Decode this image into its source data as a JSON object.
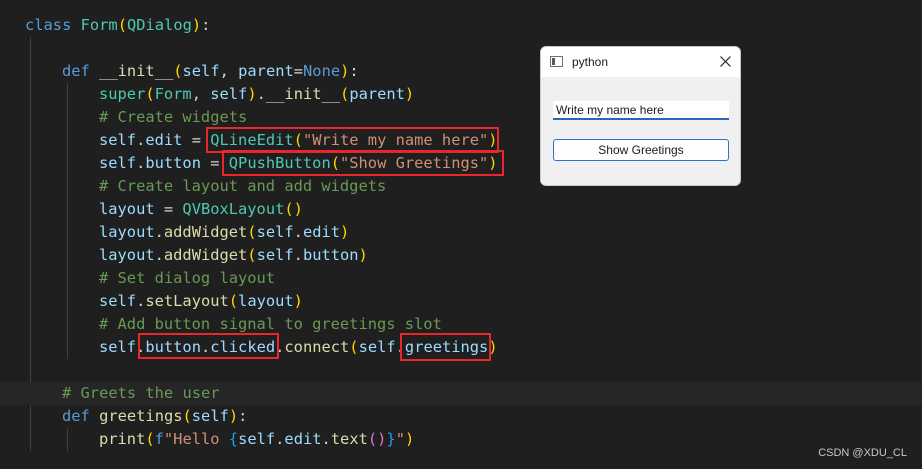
{
  "editor": {
    "colors": {
      "background": "#1f1f1f",
      "keyword": "#569cd6",
      "class": "#4ec9b0",
      "function": "#dcdcaa",
      "variable": "#9cdcfe",
      "string": "#ce9178",
      "comment": "#6a9955",
      "text": "#d4d4d4",
      "bracket1": "#ffd700",
      "bracket2": "#da70d6",
      "bracket3": "#179fff",
      "highlight_box": "#e8262b"
    },
    "lines": [
      [
        [
          "class",
          "keyword"
        ],
        [
          " ",
          "text"
        ],
        [
          "Form",
          "class"
        ],
        [
          "(",
          "bracket1"
        ],
        [
          "QDialog",
          "class"
        ],
        [
          ")",
          "bracket1"
        ],
        [
          ":",
          "text"
        ]
      ],
      [],
      [
        [
          "def",
          "keyword"
        ],
        [
          " ",
          "text"
        ],
        [
          "__init__",
          "function"
        ],
        [
          "(",
          "bracket1"
        ],
        [
          "self",
          "variable"
        ],
        [
          ", ",
          "text"
        ],
        [
          "parent",
          "variable"
        ],
        [
          "=",
          "text"
        ],
        [
          "None",
          "keyword"
        ],
        [
          ")",
          "bracket1"
        ],
        [
          ":",
          "text"
        ]
      ],
      [
        [
          "super",
          "class"
        ],
        [
          "(",
          "bracket1"
        ],
        [
          "Form",
          "class"
        ],
        [
          ", ",
          "text"
        ],
        [
          "self",
          "variable"
        ],
        [
          ")",
          "bracket1"
        ],
        [
          ".",
          "text"
        ],
        [
          "__init__",
          "function"
        ],
        [
          "(",
          "bracket1"
        ],
        [
          "parent",
          "variable"
        ],
        [
          ")",
          "bracket1"
        ]
      ],
      [
        [
          "# Create widgets",
          "comment"
        ]
      ],
      [
        [
          "self",
          "variable"
        ],
        [
          ".",
          "text"
        ],
        [
          "edit",
          "variable"
        ],
        [
          " = ",
          "text"
        ],
        [
          "QLineEdit",
          "class"
        ],
        [
          "(",
          "bracket1"
        ],
        [
          "\"Write my name here\"",
          "string"
        ],
        [
          ")",
          "bracket1"
        ]
      ],
      [
        [
          "self",
          "variable"
        ],
        [
          ".",
          "text"
        ],
        [
          "button",
          "variable"
        ],
        [
          " = ",
          "text"
        ],
        [
          "QPushButton",
          "class"
        ],
        [
          "(",
          "bracket1"
        ],
        [
          "\"Show Greetings\"",
          "string"
        ],
        [
          ")",
          "bracket1"
        ]
      ],
      [
        [
          "# Create layout and add widgets",
          "comment"
        ]
      ],
      [
        [
          "layout",
          "variable"
        ],
        [
          " = ",
          "text"
        ],
        [
          "QVBoxLayout",
          "class"
        ],
        [
          "(",
          "bracket1"
        ],
        [
          ")",
          "bracket1"
        ]
      ],
      [
        [
          "layout",
          "variable"
        ],
        [
          ".",
          "text"
        ],
        [
          "addWidget",
          "function"
        ],
        [
          "(",
          "bracket1"
        ],
        [
          "self",
          "variable"
        ],
        [
          ".",
          "text"
        ],
        [
          "edit",
          "variable"
        ],
        [
          ")",
          "bracket1"
        ]
      ],
      [
        [
          "layout",
          "variable"
        ],
        [
          ".",
          "text"
        ],
        [
          "addWidget",
          "function"
        ],
        [
          "(",
          "bracket1"
        ],
        [
          "self",
          "variable"
        ],
        [
          ".",
          "text"
        ],
        [
          "button",
          "variable"
        ],
        [
          ")",
          "bracket1"
        ]
      ],
      [
        [
          "# Set dialog layout",
          "comment"
        ]
      ],
      [
        [
          "self",
          "variable"
        ],
        [
          ".",
          "text"
        ],
        [
          "setLayout",
          "function"
        ],
        [
          "(",
          "bracket1"
        ],
        [
          "layout",
          "variable"
        ],
        [
          ")",
          "bracket1"
        ]
      ],
      [
        [
          "# Add button signal to greetings slot",
          "comment"
        ]
      ],
      [
        [
          "self",
          "variable"
        ],
        [
          ".",
          "text"
        ],
        [
          "button",
          "variable"
        ],
        [
          ".",
          "text"
        ],
        [
          "clicked",
          "variable"
        ],
        [
          ".",
          "text"
        ],
        [
          "connect",
          "function"
        ],
        [
          "(",
          "bracket1"
        ],
        [
          "self",
          "variable"
        ],
        [
          ".",
          "text"
        ],
        [
          "greetings",
          "variable"
        ],
        [
          ")",
          "bracket1"
        ]
      ],
      [],
      [
        [
          "# Greets the user",
          "comment"
        ]
      ],
      [
        [
          "def",
          "keyword"
        ],
        [
          " ",
          "text"
        ],
        [
          "greetings",
          "function"
        ],
        [
          "(",
          "bracket1"
        ],
        [
          "self",
          "variable"
        ],
        [
          ")",
          "bracket1"
        ],
        [
          ":",
          "text"
        ]
      ],
      [
        [
          "print",
          "function"
        ],
        [
          "(",
          "bracket1"
        ],
        [
          "f",
          "keyword"
        ],
        [
          "\"Hello ",
          "string"
        ],
        [
          "{",
          "bracket3"
        ],
        [
          "self",
          "variable"
        ],
        [
          ".",
          "text"
        ],
        [
          "edit",
          "variable"
        ],
        [
          ".",
          "text"
        ],
        [
          "text",
          "function"
        ],
        [
          "(",
          "bracket2"
        ],
        [
          ")",
          "bracket2"
        ],
        [
          "}",
          "bracket3"
        ],
        [
          "\"",
          "string"
        ],
        [
          ")",
          "bracket1"
        ]
      ]
    ]
  },
  "dialog": {
    "title": "python",
    "input_value": "Write my name here",
    "button_label": "Show Greetings",
    "icons": [
      "app-window-icon",
      "close-icon"
    ],
    "accent": "#2667c4"
  },
  "watermark": "CSDN @XDU_CL"
}
